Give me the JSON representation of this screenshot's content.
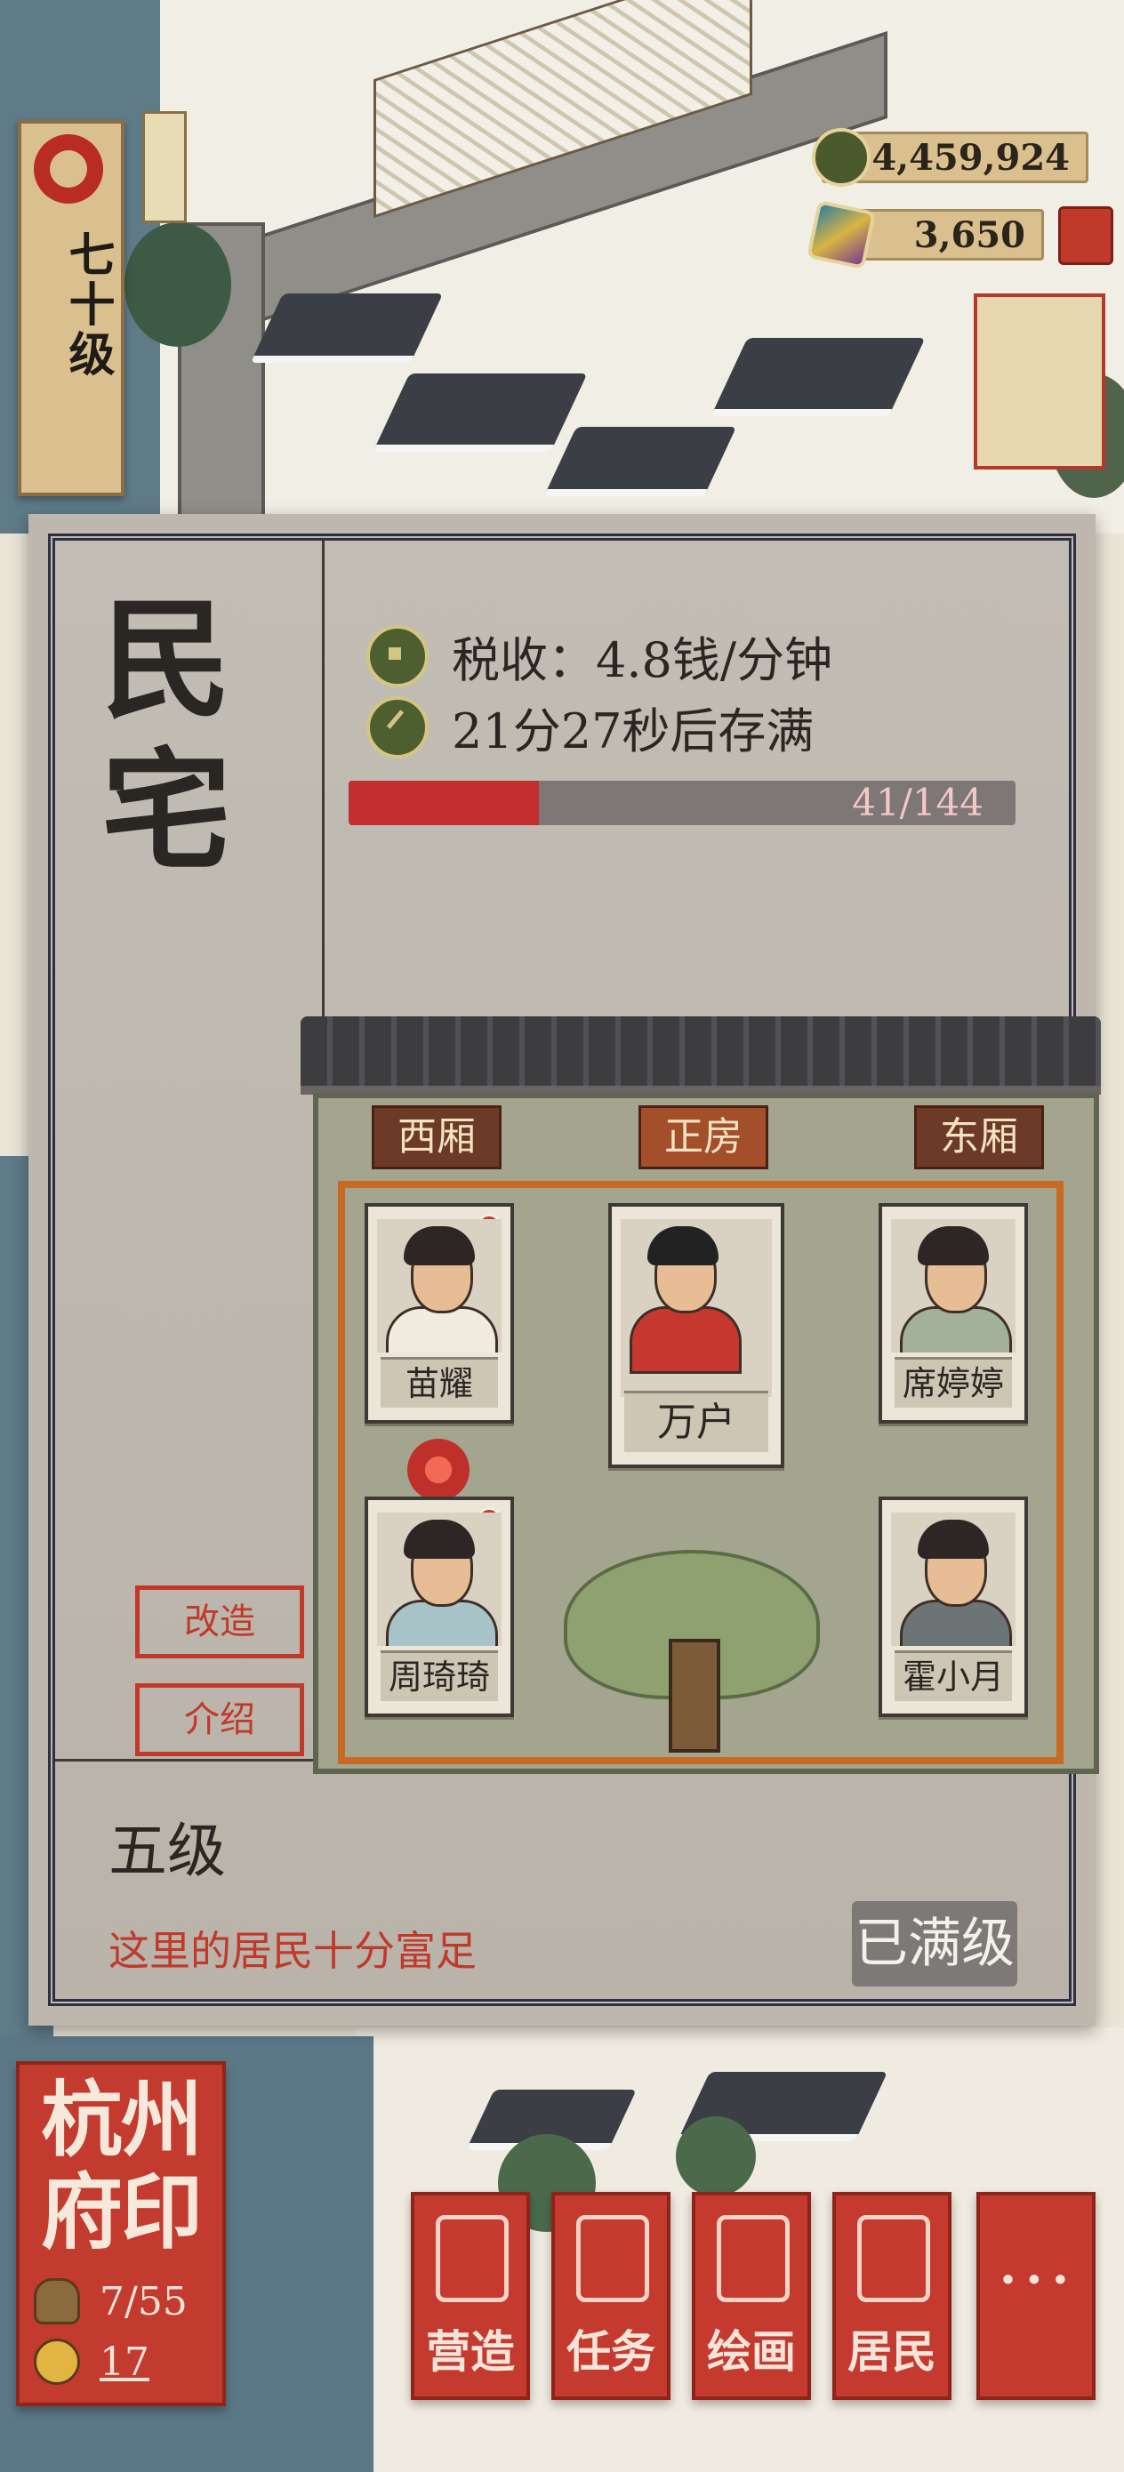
{
  "player": {
    "level": "七十级"
  },
  "currency": {
    "coins": "4,459,924",
    "gems": "3,650"
  },
  "building": {
    "name": "民宅",
    "tax": "税收：4.8钱/分钟",
    "full_timer": "21分27秒后存满",
    "storage_current": 41,
    "storage_max": 144,
    "storage_label": "41/144",
    "storage_fill": 0.285,
    "rooms": {
      "west": "西厢",
      "main": "正房",
      "east": "东厢"
    },
    "residents": [
      {
        "name": "苗耀"
      },
      {
        "name": "万户"
      },
      {
        "name": "席婷婷"
      },
      {
        "name": "周琦琦"
      },
      {
        "name": "霍小月"
      }
    ],
    "actions": {
      "renovate": "改造",
      "intro": "介绍"
    },
    "grade": "五级",
    "description": "这里的居民十分富足",
    "max_label": "已满级"
  },
  "seal": {
    "title": "杭州府印",
    "population": "7/55",
    "count": "17"
  },
  "nav": {
    "build": "营造",
    "tasks": "任务",
    "paint": "绘画",
    "residents": "居民",
    "more": "···"
  },
  "colors": {
    "accent_red": "#c0392b",
    "progress_fill": "#c42e2f",
    "panel_border": "#2e2f44"
  }
}
